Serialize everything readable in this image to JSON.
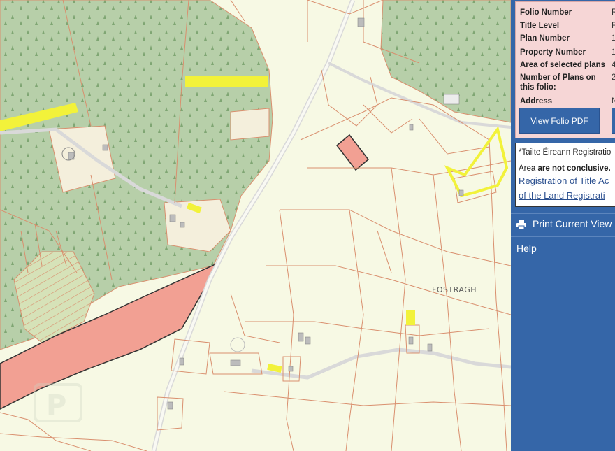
{
  "folio_info": {
    "rows": [
      {
        "label": "Folio Number",
        "value": "R"
      },
      {
        "label": "Title Level",
        "value": "F"
      },
      {
        "label": "Plan Number",
        "value": "1"
      },
      {
        "label": "Property Number",
        "value": "1"
      },
      {
        "label": "Area of selected plans",
        "value": "4"
      },
      {
        "label": "Number of Plans on this folio:",
        "value": "2"
      },
      {
        "label": "Address",
        "value": "N"
      }
    ],
    "view_pdf_label": "View Folio PDF"
  },
  "notice": {
    "line1": "*Tailte Éireann Registratio",
    "line2_pre": "Area ",
    "line2_bold": "are not conclusive.",
    "link1": "Registration of Title Ac",
    "link2": "of the Land Registrati"
  },
  "menu": {
    "print_label": "Print Current View",
    "help_label": "Help"
  },
  "map": {
    "townland_label": "FOSTRAGH"
  },
  "colors": {
    "panel_blue": "#3566a8",
    "info_pink": "#f6d6d6",
    "map_bg": "#f7f9e4",
    "forest": "#b7cfa9",
    "boundary": "#d98f6e",
    "selected_plot": "#f2a093",
    "highlight_yellow": "#f2f23a"
  }
}
